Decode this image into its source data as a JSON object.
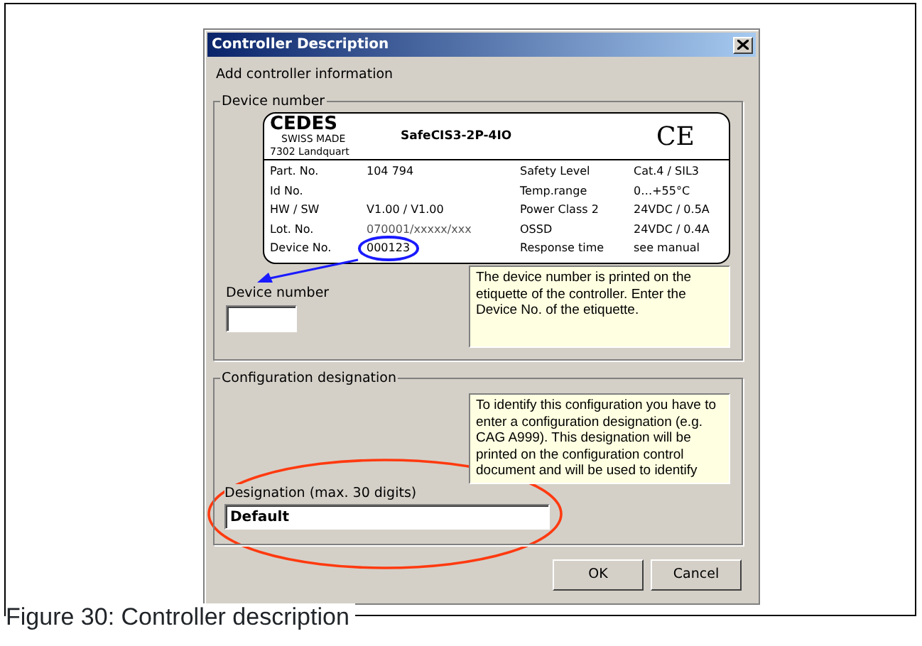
{
  "dialog": {
    "title": "Controller Description",
    "intro": "Add controller information",
    "device_group": {
      "legend": "Device number",
      "etiquette": {
        "brand": "CEDES",
        "origin": "SWISS MADE",
        "location": "7302 Landquart",
        "model": "SafeCIS3-2P-4IO",
        "mark": "CE",
        "rows": [
          {
            "label": "Part. No.",
            "value": "104 794",
            "label_2": "Safety Level",
            "value_2": "Cat.4 / SIL3"
          },
          {
            "label": "Id No.",
            "value": "",
            "label_2": "Temp.range",
            "value_2": "0…+55°C"
          },
          {
            "label": "HW / SW",
            "value": "V1.00 / V1.00",
            "label_2": "Power Class 2",
            "value_2": "24VDC / 0.5A"
          },
          {
            "label": "Lot. No.",
            "value": "070001/xxxxx/xxx",
            "label_2": "OSSD",
            "value_2": "24VDC / 0.4A"
          },
          {
            "label": "Device No.",
            "value": "000123",
            "label_2": "Response time",
            "value_2": "see manual"
          }
        ]
      },
      "field_label": "Device number",
      "hint": "The device number is printed on the etiquette of the controller. Enter the Device No. of the etiquette."
    },
    "config_group": {
      "legend": "Configuration designation",
      "hint": "To identify this configuration you have to enter a configuration designation (e.g. CAG A999). This designation will be printed on the configuration control document and will be used to identify",
      "field_label": "Designation (max. 30 digits)",
      "field_value": "Default"
    },
    "buttons": [
      {
        "label": "OK"
      },
      {
        "label": "Cancel"
      }
    ]
  },
  "caption": "Figure 30: Controller description"
}
